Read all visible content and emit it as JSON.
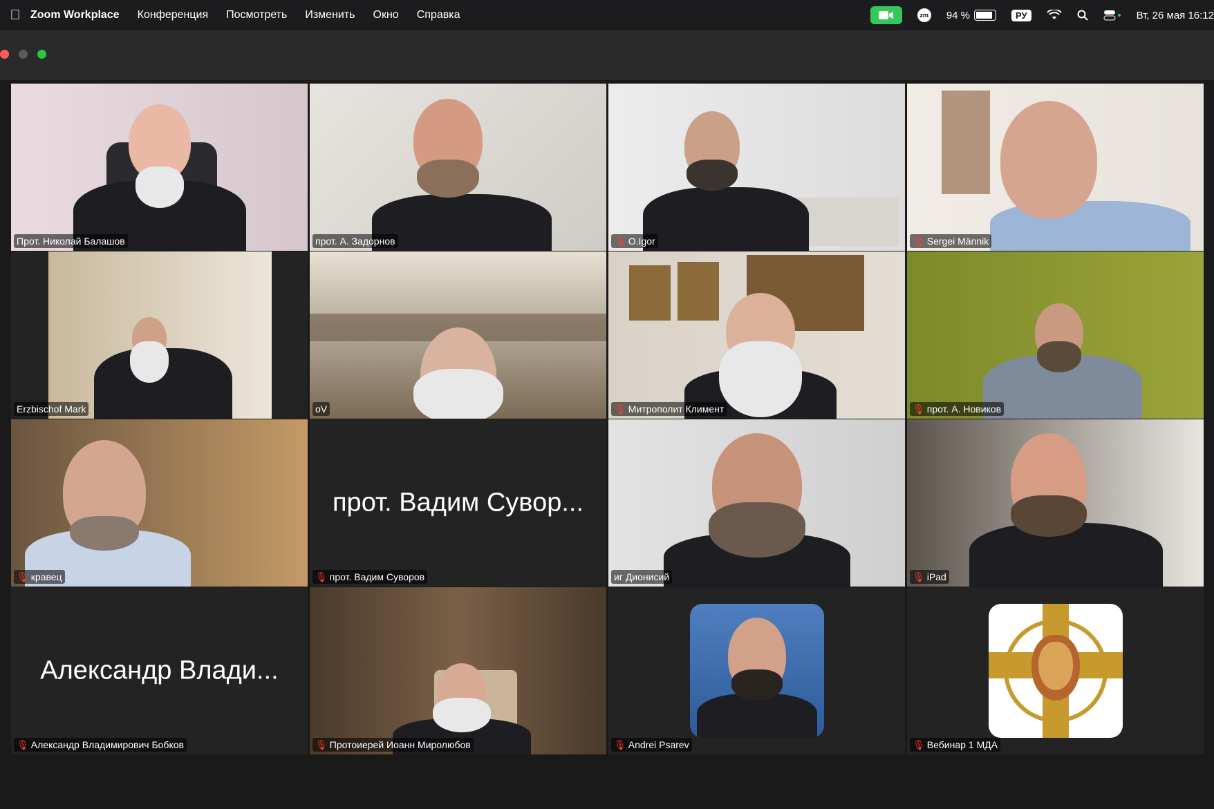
{
  "menubar": {
    "app_name": "Zoom Workplace",
    "menus": [
      "Конференция",
      "Посмотреть",
      "Изменить",
      "Окно",
      "Справка"
    ],
    "zm_label": "zm",
    "battery": "94 %",
    "battery_level": 0.94,
    "keyboard_layout": "РУ",
    "datetime": "Вт, 26 мая  16:12"
  },
  "window": {
    "traffic_light_colors": {
      "close": "#ff5f57",
      "minimize": "#5a5a5a",
      "maximize": "#28c840"
    }
  },
  "participants": [
    {
      "name": "Прот. Николай Балашов",
      "muted": false,
      "video": true,
      "active_speaker": false
    },
    {
      "name": "прот. А. Задорнов",
      "muted": false,
      "video": true,
      "active_speaker": true
    },
    {
      "name": "O.Igor",
      "muted": true,
      "video": true,
      "active_speaker": false
    },
    {
      "name": "Sergei Männik",
      "muted": true,
      "video": true,
      "active_speaker": false
    },
    {
      "name": "Erzbischof Mark",
      "muted": false,
      "video": true,
      "active_speaker": false
    },
    {
      "name": "oV",
      "muted": false,
      "video": true,
      "active_speaker": false
    },
    {
      "name": "Митрополит Климент",
      "muted": true,
      "video": true,
      "active_speaker": false
    },
    {
      "name": "прот. А. Новиков",
      "muted": true,
      "video": true,
      "active_speaker": false
    },
    {
      "name": "кравец",
      "muted": true,
      "video": true,
      "active_speaker": false
    },
    {
      "name": "прот. Вадим Суворов",
      "display_name": "прот. Вадим Сувор...",
      "muted": true,
      "video": false,
      "active_speaker": false
    },
    {
      "name": "иг Дионисий",
      "muted": false,
      "video": true,
      "active_speaker": false
    },
    {
      "name": "iPad",
      "muted": true,
      "video": true,
      "active_speaker": false
    },
    {
      "name": "Александр Владимирович Бобков",
      "display_name": "Александр Влади...",
      "muted": true,
      "video": false,
      "active_speaker": false
    },
    {
      "name": "Протоиерей Иоанн Миролюбов",
      "muted": true,
      "video": true,
      "active_speaker": false
    },
    {
      "name": "Andrei Psarev",
      "muted": true,
      "video": false,
      "active_speaker": false,
      "avatar": "photo"
    },
    {
      "name": "Вебинар 1 МДА",
      "muted": true,
      "video": false,
      "active_speaker": false,
      "avatar": "logo"
    }
  ],
  "colors": {
    "active_speaker_border": "#2ecc40",
    "muted_icon": "#ff3b30",
    "video_button": "#34c759"
  }
}
